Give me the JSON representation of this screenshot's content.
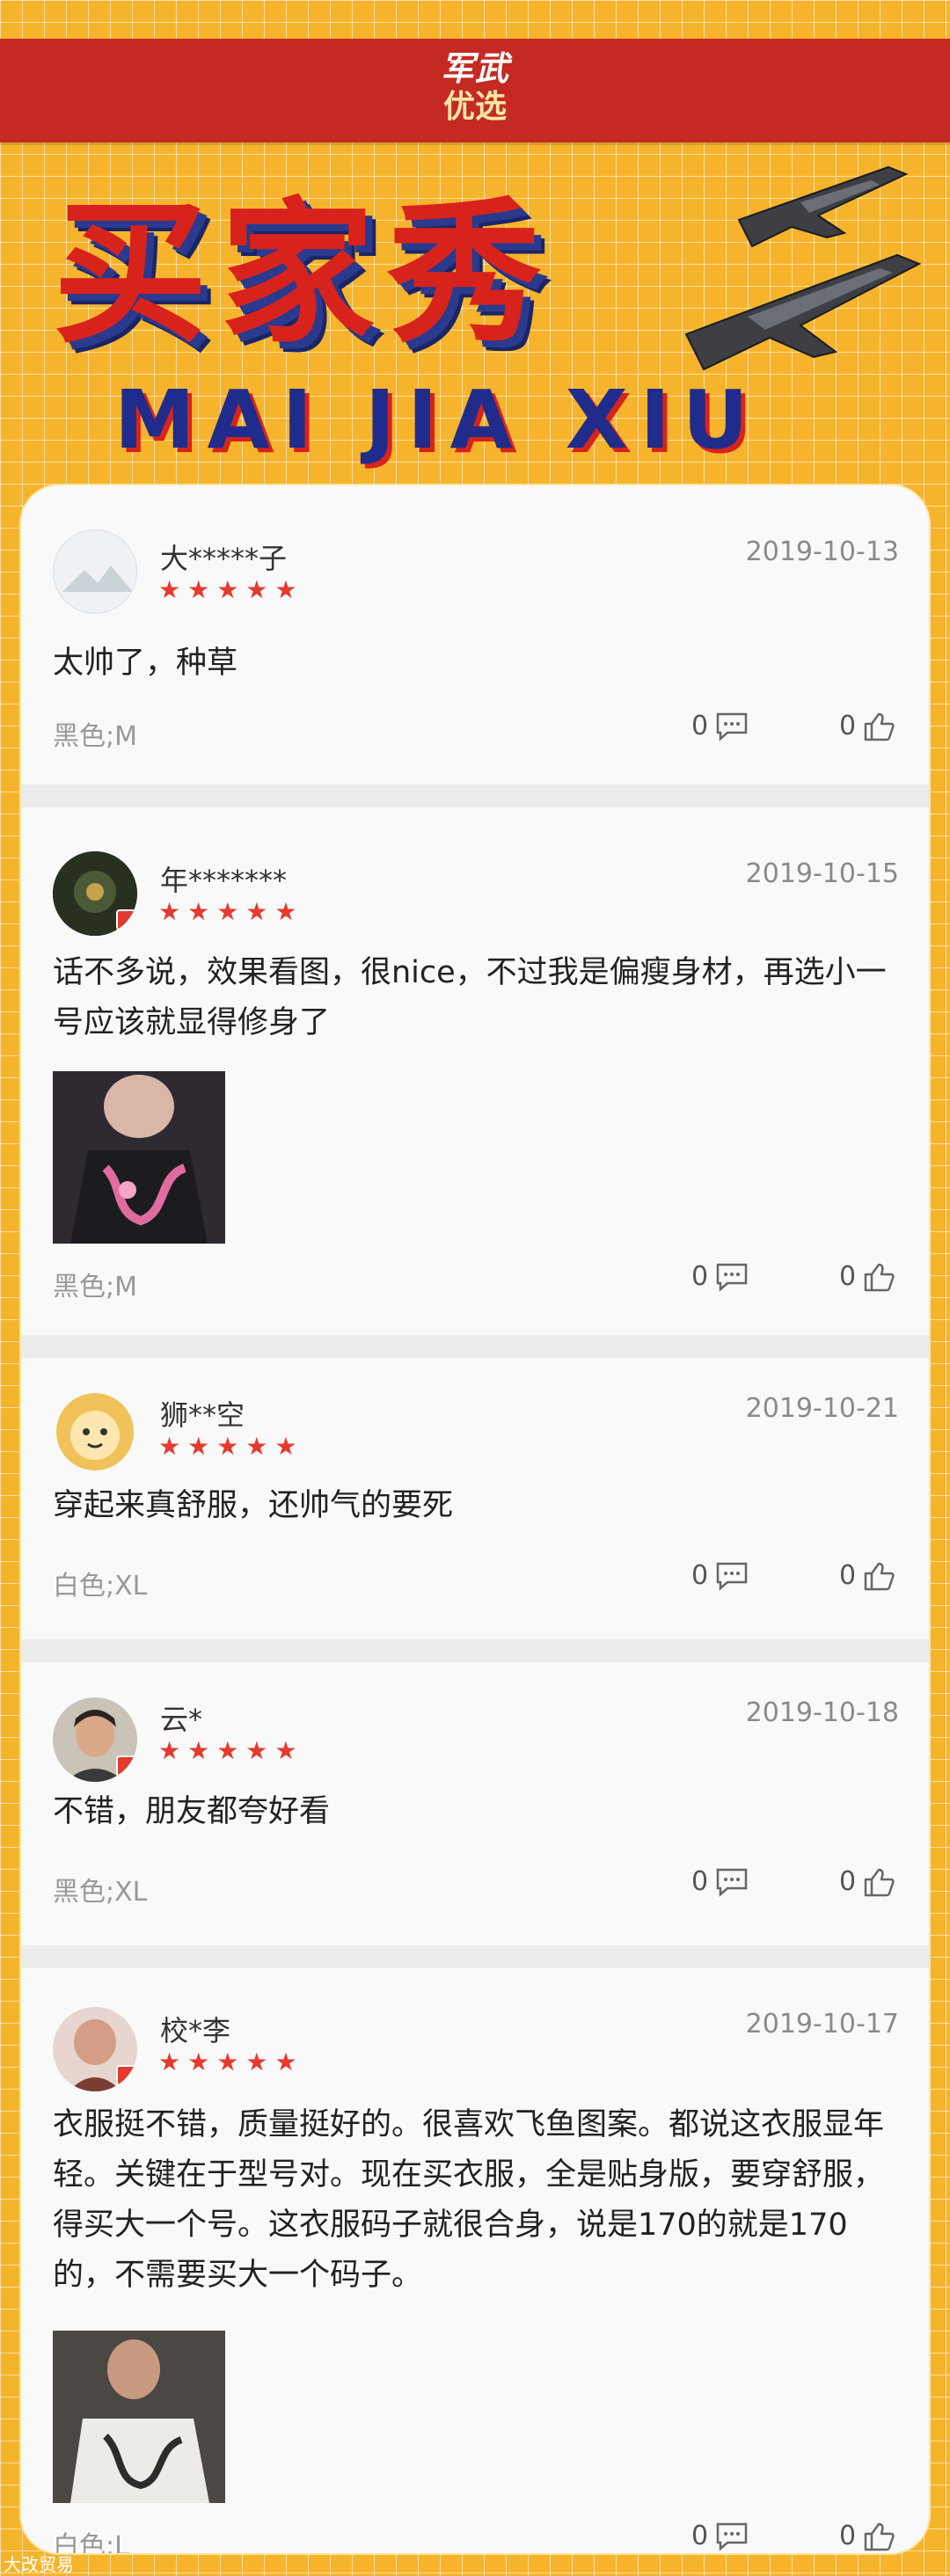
{
  "header": {
    "logo_line1": "军武",
    "logo_line2": "优选",
    "title": "买家秀",
    "subtitle": "MAI JIA XIU"
  },
  "reviews": [
    {
      "user": "大*****子",
      "rating": 5,
      "stars": "★★★★★",
      "date": "2019-10-13",
      "content": "太帅了，种草",
      "spec": "黑色;M",
      "comments": "0",
      "likes": "0"
    },
    {
      "user": "年*******",
      "rating": 5,
      "stars": "★★★★★",
      "date": "2019-10-15",
      "content": "话不多说，效果看图，很nice，不过我是偏瘦身材，再选小一号应该就显得修身了",
      "spec": "黑色;M",
      "comments": "0",
      "likes": "0"
    },
    {
      "user": "狮**空",
      "rating": 5,
      "stars": "★★★★★",
      "date": "2019-10-21",
      "content": "穿起来真舒服，还帅气的要死",
      "spec": "白色;XL",
      "comments": "0",
      "likes": "0"
    },
    {
      "user": "云*",
      "rating": 5,
      "stars": "★★★★★",
      "date": "2019-10-18",
      "content": "不错，朋友都夸好看",
      "spec": "黑色;XL",
      "comments": "0",
      "likes": "0"
    },
    {
      "user": "校*李",
      "rating": 5,
      "stars": "★★★★★",
      "date": "2019-10-17",
      "content": "衣服挺不错，质量挺好的。很喜欢飞鱼图案。都说这衣服显年轻。关键在于型号对。现在买衣服，全是贴身版，要穿舒服，得买大一个号。这衣服码子就很合身，说是170的就是170的，不需要买大一个码子。",
      "spec": "白色;L",
      "comments": "0",
      "likes": "0"
    }
  ],
  "footer": {
    "watermark": "大改贸易"
  },
  "colors": {
    "background": "#f6b42c",
    "topbar": "#c42a22",
    "title_red": "#d8221c",
    "title_blue": "#1f2c8c",
    "star": "#e53a2f"
  }
}
